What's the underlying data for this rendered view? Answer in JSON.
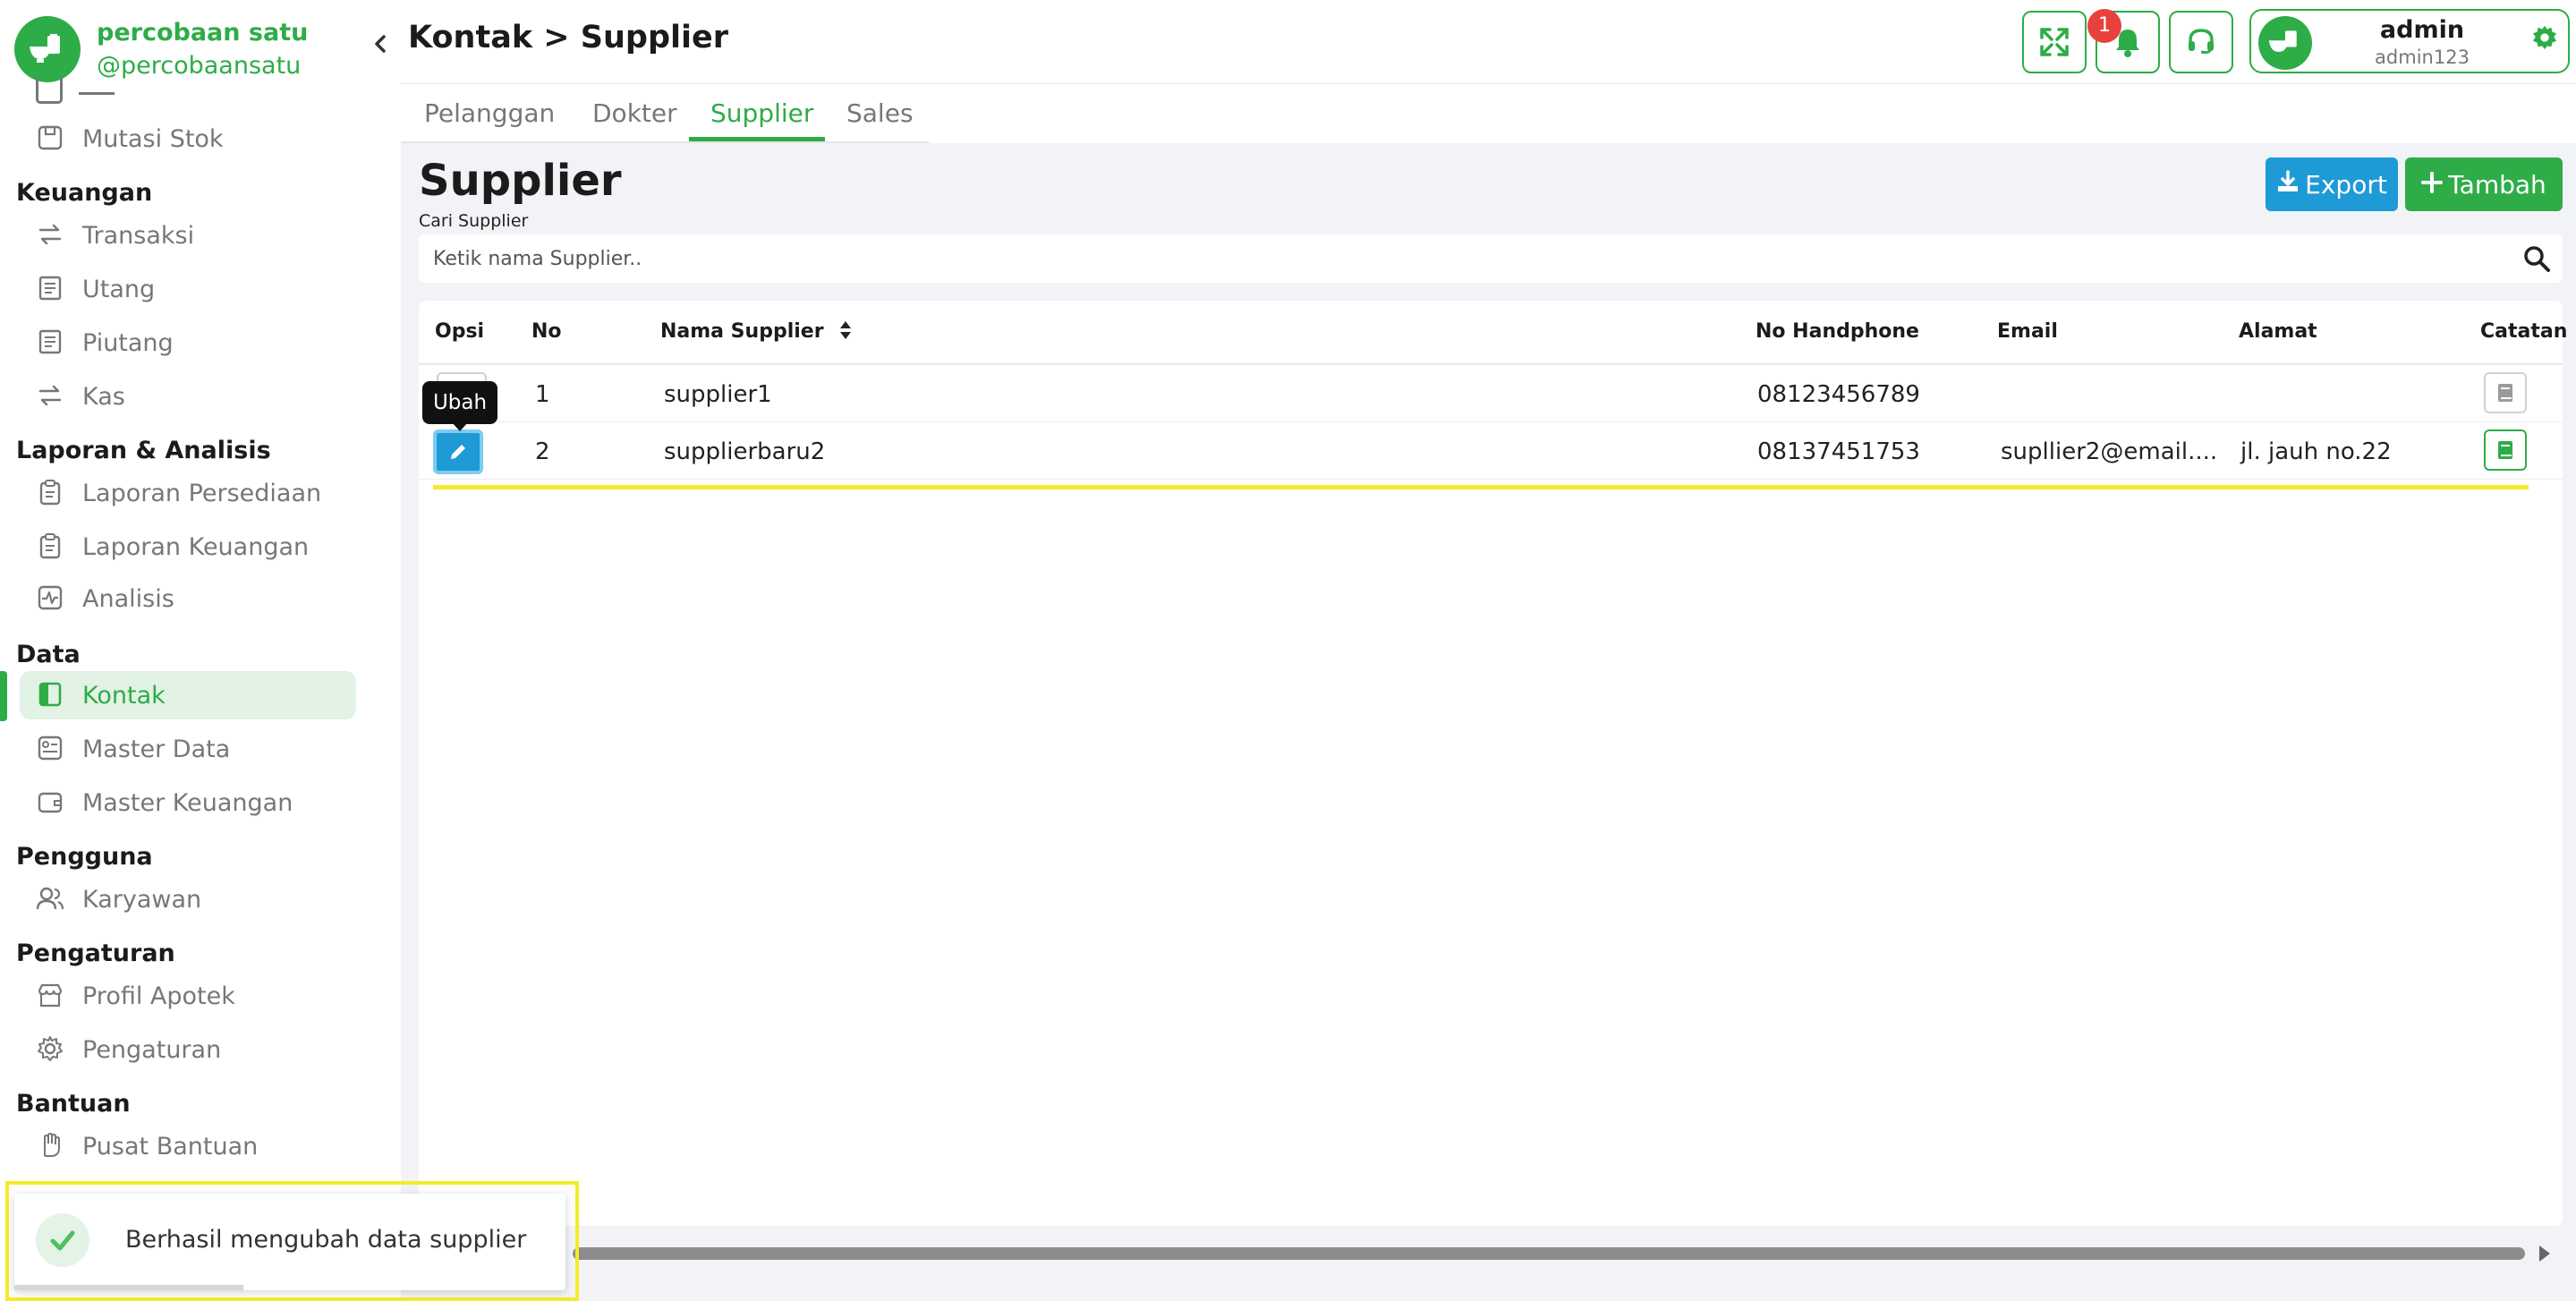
{
  "brand": {
    "name": "percobaan satu",
    "handle": "@percobaansatu",
    "collapse_icon": "chevron-left-icon"
  },
  "sidebar": {
    "sections": [
      {
        "title": "",
        "items": [
          {
            "label": "Mutasi Stok",
            "icon": "box-icon",
            "active": false
          }
        ]
      },
      {
        "title": "Keuangan",
        "items": [
          {
            "label": "Transaksi",
            "icon": "exchange-icon",
            "active": false
          },
          {
            "label": "Utang",
            "icon": "receipt-icon",
            "active": false
          },
          {
            "label": "Piutang",
            "icon": "receipt-icon",
            "active": false
          },
          {
            "label": "Kas",
            "icon": "exchange-icon",
            "active": false
          }
        ]
      },
      {
        "title": "Laporan & Analisis",
        "items": [
          {
            "label": "Laporan Persediaan",
            "icon": "clipboard-icon",
            "active": false
          },
          {
            "label": "Laporan Keuangan",
            "icon": "clipboard-icon",
            "active": false
          },
          {
            "label": "Analisis",
            "icon": "activity-icon",
            "active": false
          }
        ]
      },
      {
        "title": "Data",
        "items": [
          {
            "label": "Kontak",
            "icon": "contact-book-icon",
            "active": true
          },
          {
            "label": "Master Data",
            "icon": "database-icon",
            "active": false
          },
          {
            "label": "Master Keuangan",
            "icon": "wallet-icon",
            "active": false
          }
        ]
      },
      {
        "title": "Pengguna",
        "items": [
          {
            "label": "Karyawan",
            "icon": "users-icon",
            "active": false
          }
        ]
      },
      {
        "title": "Pengaturan",
        "items": [
          {
            "label": "Profil Apotek",
            "icon": "store-icon",
            "active": false
          },
          {
            "label": "Pengaturan",
            "icon": "gear-icon",
            "active": false
          }
        ]
      },
      {
        "title": "Bantuan",
        "items": [
          {
            "label": "Pusat Bantuan",
            "icon": "hand-icon",
            "active": false
          }
        ]
      }
    ]
  },
  "header": {
    "breadcrumb": "Kontak > Supplier",
    "notification_count": "1",
    "user_name": "admin",
    "user_id": "admin123"
  },
  "tabs": [
    {
      "label": "Pelanggan",
      "active": false
    },
    {
      "label": "Dokter",
      "active": false
    },
    {
      "label": "Supplier",
      "active": true
    },
    {
      "label": "Sales",
      "active": false
    }
  ],
  "main": {
    "title": "Supplier",
    "export_label": "Export",
    "add_label": "Tambah",
    "search_label": "Cari Supplier",
    "search_placeholder": "Ketik nama Supplier.."
  },
  "table": {
    "columns": [
      "Opsi",
      "No",
      "Nama Supplier",
      "No Handphone",
      "Email",
      "Alamat",
      "Catatan"
    ],
    "rows": [
      {
        "no": "1",
        "name": "supplier1",
        "phone": "08123456789",
        "email": "",
        "address": "",
        "has_note": false
      },
      {
        "no": "2",
        "name": "supplierbaru2",
        "phone": "08137451753",
        "email": "supllier2@email....",
        "address": "jl. jauh no.22",
        "has_note": true
      }
    ]
  },
  "tooltip": {
    "text": "Ubah"
  },
  "toast": {
    "message": "Berhasil mengubah data supplier"
  },
  "colors": {
    "brand_green": "#2eac48",
    "export_blue": "#1e9ad6",
    "badge_red": "#e8413d",
    "highlight_yellow": "#f6ea2b",
    "page_bg": "#f2f3f7"
  }
}
